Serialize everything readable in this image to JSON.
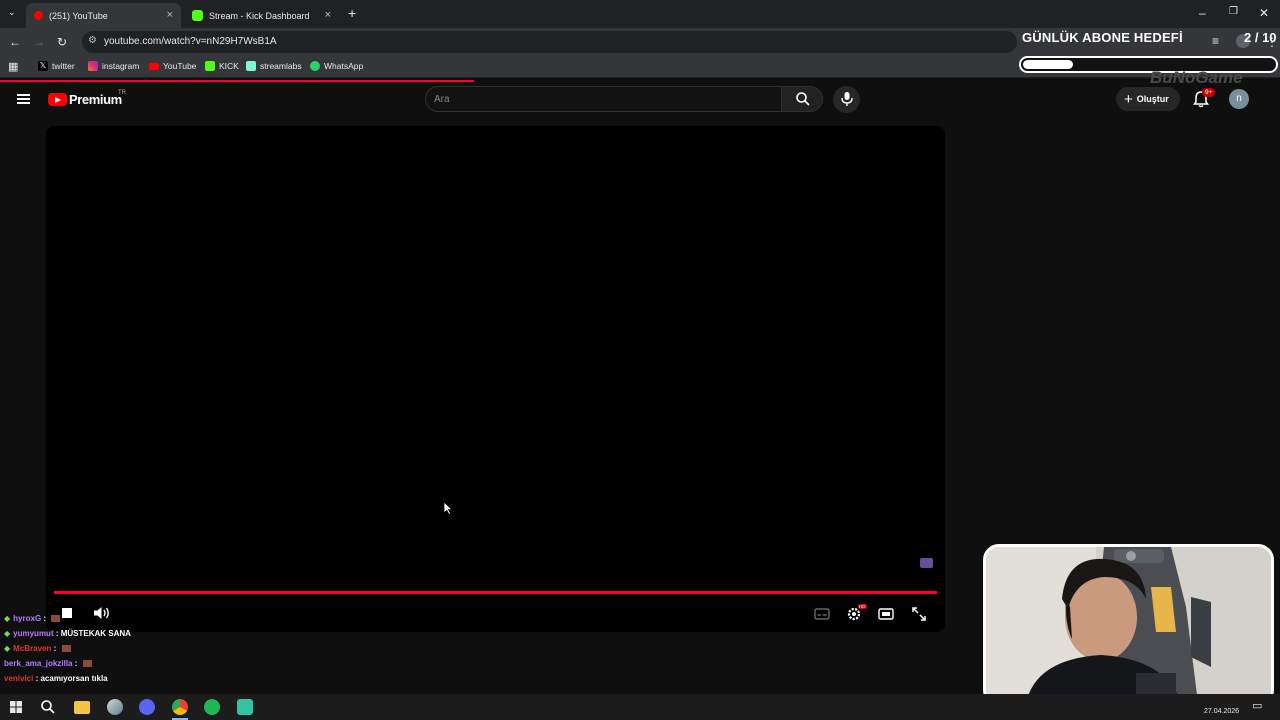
{
  "browser": {
    "tabs": [
      {
        "label": "(251) YouTube",
        "active": true
      },
      {
        "label": "Stream - Kick Dashboard",
        "active": false
      }
    ],
    "new_tab": "+",
    "url": "youtube.com/watch?v=nN29H7WsB1A",
    "bookmarks": [
      {
        "label": "twitter",
        "icon": "x-icon"
      },
      {
        "label": "instagram",
        "icon": "instagram-icon"
      },
      {
        "label": "YouTube",
        "icon": "youtube-icon"
      },
      {
        "label": "KICK",
        "icon": "kick-icon"
      },
      {
        "label": "streamlabs",
        "icon": "streamlabs-icon"
      },
      {
        "label": "WhatsApp",
        "icon": "whatsapp-icon"
      }
    ],
    "page_load_progress": 0.37
  },
  "overlay": {
    "goal_title": "GÜNLÜK ABONE HEDEFİ",
    "goal_count": "2 / 10",
    "goal_current": 2,
    "goal_target": 10,
    "watermark": "BuNoGame"
  },
  "youtube": {
    "logo_text": "Premium",
    "region": "TR",
    "search_placeholder": "Ara",
    "create_label": "Oluştur",
    "notification_badge": "9+",
    "avatar_letter": "n"
  },
  "player": {
    "progress": 1.0,
    "hd_badge": "HD"
  },
  "chat": [
    {
      "user": "hyroxG",
      "message": "",
      "user_color": "#b57cff",
      "diamond": true,
      "emote": true
    },
    {
      "user": "yumyumut",
      "message": "MÜSTEKAK SANA",
      "user_color": "#b57cff",
      "diamond": true,
      "emote": false
    },
    {
      "user": "McBraven",
      "message": "",
      "user_color": "#e0372b",
      "diamond": true,
      "emote": true
    },
    {
      "user": "berk_ama_jokzilla",
      "message": "",
      "user_color": "#b57cff",
      "diamond": false,
      "emote": true
    },
    {
      "user": "venivici",
      "message": "acamıyorsan tıkla",
      "user_color": "#e0372b",
      "diamond": false,
      "emote": false
    }
  ],
  "taskbar": {
    "date": "27.04.2026"
  },
  "colors": {
    "accent": "#ff0033",
    "background": "#0f0f0f"
  }
}
